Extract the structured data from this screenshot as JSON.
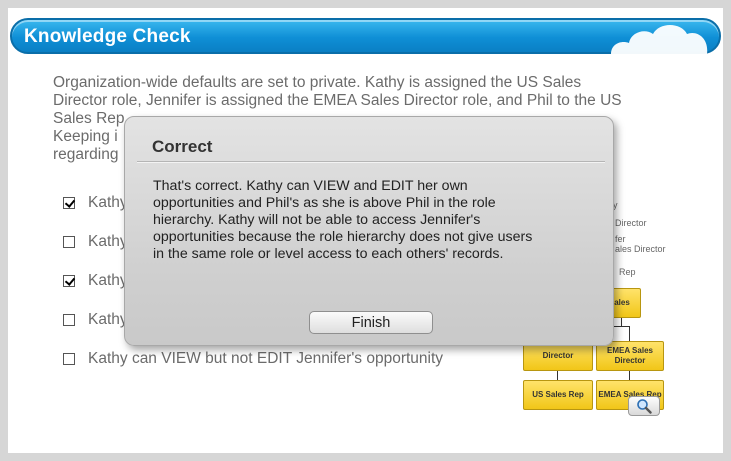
{
  "header": {
    "title": "Knowledge Check"
  },
  "question": {
    "lines": [
      "Organization-wide defaults are set to private. Kathy is assigned the US Sales",
      "Director role, Jennifer is assigned the EMEA Sales Director role, and Phil to the US",
      "Sales Rep",
      "Keeping i",
      "regarding"
    ]
  },
  "options": [
    {
      "label": "Kathy",
      "checked": true
    },
    {
      "label": "Kathy",
      "checked": false
    },
    {
      "label": "Kathy",
      "checked": true
    },
    {
      "label": "Kathy",
      "checked": false
    },
    {
      "label": "Kathy can VIEW but not EDIT Jennifer's opportunity",
      "checked": false
    }
  ],
  "diagram": {
    "labels": [
      "y",
      "Director",
      "fer",
      "ales Director",
      "Rep"
    ],
    "boxes": [
      "ales",
      "Director",
      "EMEA Sales Director",
      "US Sales Rep",
      "EMEA Sales Rep"
    ],
    "zoom_icon": "magnifier-icon"
  },
  "dialog": {
    "title": "Correct",
    "body_lines": [
      "That's correct. Kathy can VIEW and EDIT her own",
      "opportunities and Phil's as she is above Phil in the role",
      "hierarchy. Kathy will not be able to access Jennifer's",
      "opportunities because the role hierarchy does not give users",
      "in the same role or level access to each others' records."
    ],
    "button_label": "Finish"
  },
  "colors": {
    "title_bar": "#0f8fd6",
    "checked_mark": "#000000",
    "diagram_box": "#f1c618"
  }
}
